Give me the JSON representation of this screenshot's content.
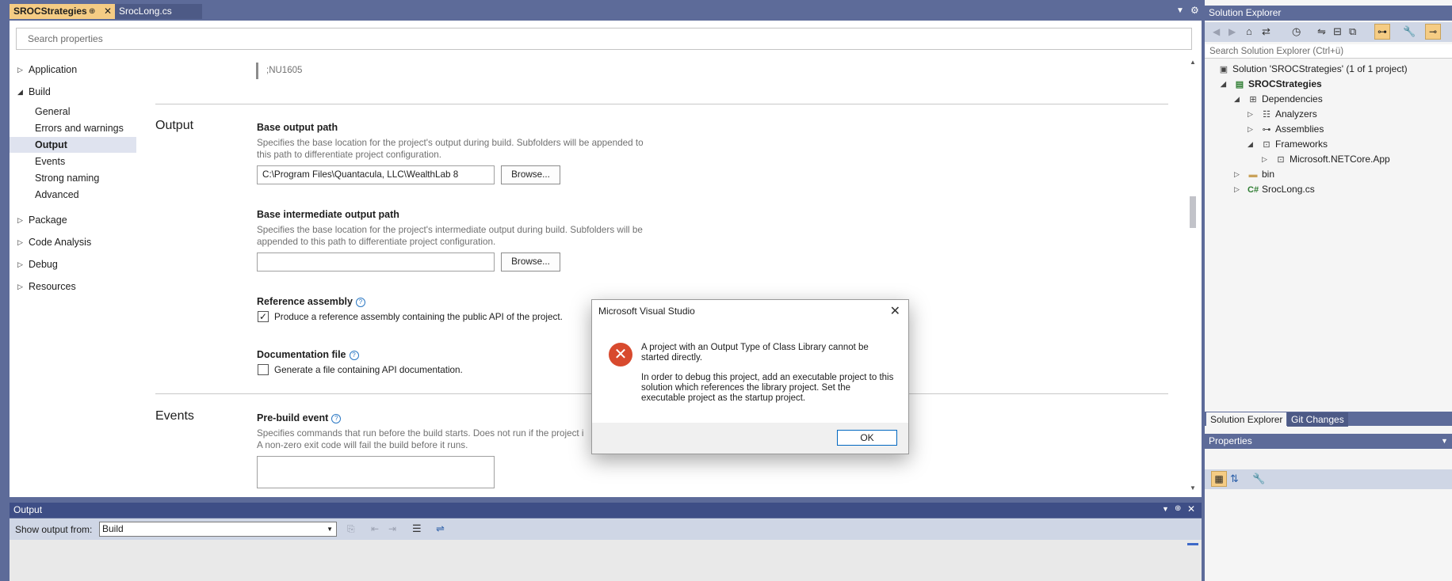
{
  "tabs": {
    "active": "SROCStrategies",
    "active_pin": "⊕",
    "other": "SrocLong.cs"
  },
  "search_properties": {
    "placeholder": "Search properties"
  },
  "nav": {
    "application": "Application",
    "build": "Build",
    "general": "General",
    "errors": "Errors and warnings",
    "output": "Output",
    "events": "Events",
    "strong": "Strong naming",
    "advanced": "Advanced",
    "package": "Package",
    "code_analysis": "Code Analysis",
    "debug": "Debug",
    "resources": "Resources"
  },
  "content": {
    "suppress_value": ";NU1605",
    "output_section": "Output",
    "base_output_label": "Base output path",
    "base_output_desc": "Specifies the base location for the project's output during build. Subfolders will be appended to this path to differentiate project configuration.",
    "base_output_value": "C:\\Program Files\\Quantacula, LLC\\WealthLab 8",
    "browse": "Browse...",
    "base_inter_label": "Base intermediate output path",
    "base_inter_desc": "Specifies the base location for the project's intermediate output during build. Subfolders will be appended to this path to differentiate project configuration.",
    "base_inter_value": "",
    "ref_asm_label": "Reference assembly",
    "ref_asm_check": "Produce a reference assembly containing the public API of the project.",
    "doc_file_label": "Documentation file",
    "doc_file_check": "Generate a file containing API documentation.",
    "events_section": "Events",
    "prebuild_label": "Pre-build event",
    "prebuild_desc1": "Specifies commands that run before the build starts. Does not run if the project i",
    "prebuild_desc2": "A non-zero exit code will fail the build before it runs."
  },
  "output_panel": {
    "title": "Output",
    "show_from": "Show output from:",
    "source": "Build"
  },
  "solution_explorer": {
    "title": "Solution Explorer",
    "search": "Search Solution Explorer (Ctrl+ü)",
    "items": [
      "Solution 'SROCStrategies' (1 of 1 project)",
      "SROCStrategies",
      "Dependencies",
      "Analyzers",
      "Assemblies",
      "Frameworks",
      "Microsoft.NETCore.App",
      "bin",
      "SrocLong.cs"
    ],
    "tab_se": "Solution Explorer",
    "tab_git": "Git Changes"
  },
  "properties": {
    "title": "Properties"
  },
  "dialog": {
    "title": "Microsoft Visual Studio",
    "message1": "A project with an Output Type of Class Library cannot be started directly.",
    "message2": "In order to debug this project, add an executable project to this solution which references the library project. Set the executable project as the startup project.",
    "ok": "OK"
  }
}
